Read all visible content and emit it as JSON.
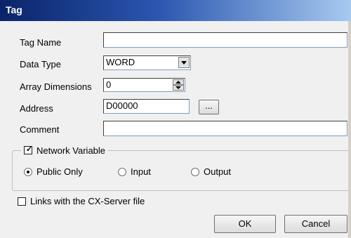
{
  "window": {
    "title": "Tag"
  },
  "fields": {
    "tag_name": {
      "label": "Tag Name",
      "value": ""
    },
    "data_type": {
      "label": "Data Type",
      "value": "WORD"
    },
    "array_dimensions": {
      "label": "Array Dimensions",
      "value": "0"
    },
    "address": {
      "label": "Address",
      "value": "D00000",
      "browse_label": "..."
    },
    "comment": {
      "label": "Comment",
      "value": ""
    }
  },
  "network_variable": {
    "label": "Network Variable",
    "checked": true,
    "options": [
      {
        "label": "Public Only",
        "selected": true
      },
      {
        "label": "Input",
        "selected": false
      },
      {
        "label": "Output",
        "selected": false
      }
    ]
  },
  "links": {
    "label": "Links with the CX-Server file",
    "checked": false
  },
  "buttons": {
    "ok": "OK",
    "cancel": "Cancel"
  }
}
